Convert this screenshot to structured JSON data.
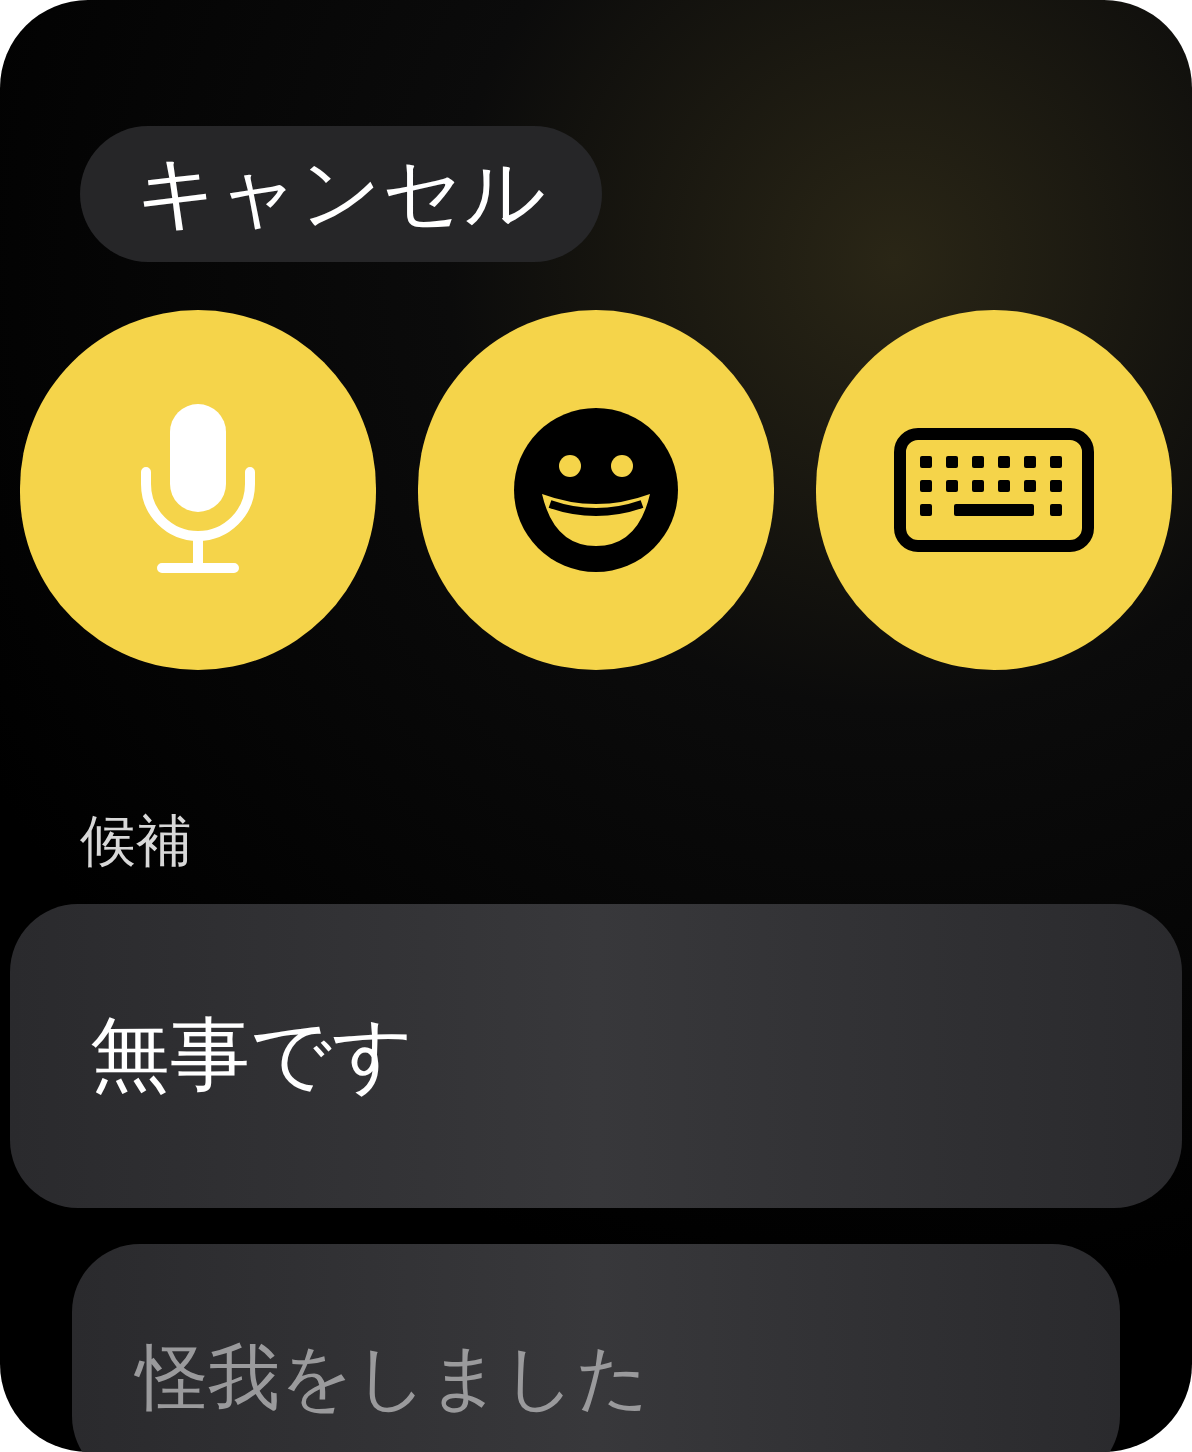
{
  "cancel_button": {
    "label": "キャンセル"
  },
  "input_options": [
    {
      "kind": "dictation"
    },
    {
      "kind": "emoji"
    },
    {
      "kind": "keyboard"
    }
  ],
  "suggestions": {
    "heading": "候補",
    "items": [
      {
        "label": "無事です",
        "dimmed": false
      },
      {
        "label": "怪我をしました",
        "dimmed": true
      }
    ]
  }
}
